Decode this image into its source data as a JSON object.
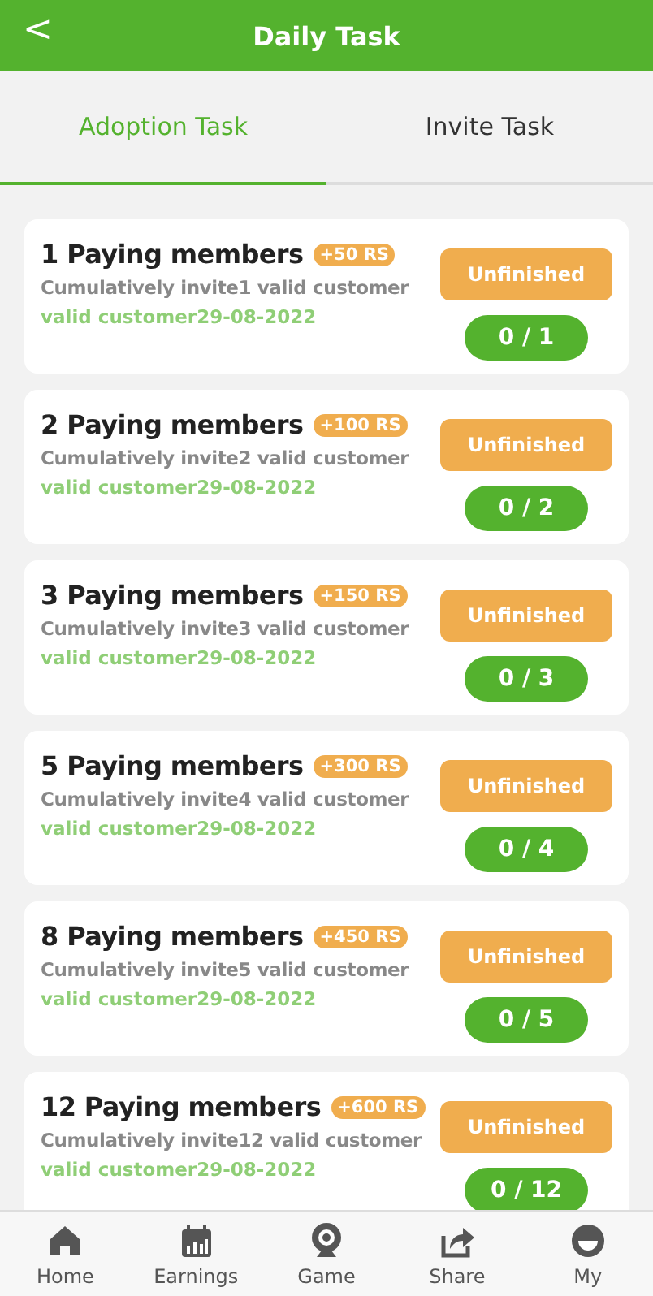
{
  "header": {
    "back": "<",
    "title": "Daily Task"
  },
  "tabs": [
    {
      "label": "Adoption Task",
      "selected": true
    },
    {
      "label": "Invite Task",
      "selected": false
    }
  ],
  "tasks": [
    {
      "title": "1 Paying members",
      "reward": "+50 RS",
      "description": "Cumulatively invite1 valid customer",
      "date": "valid customer29-08-2022",
      "status": "Unfinished",
      "progress": "0 / 1"
    },
    {
      "title": "2 Paying members",
      "reward": "+100 RS",
      "description": "Cumulatively invite2 valid customer",
      "date": "valid customer29-08-2022",
      "status": "Unfinished",
      "progress": "0 / 2"
    },
    {
      "title": "3 Paying members",
      "reward": "+150 RS",
      "description": "Cumulatively invite3 valid customer",
      "date": "valid customer29-08-2022",
      "status": "Unfinished",
      "progress": "0 / 3"
    },
    {
      "title": "5 Paying members",
      "reward": "+300 RS",
      "description": "Cumulatively invite4 valid customer",
      "date": "valid customer29-08-2022",
      "status": "Unfinished",
      "progress": "0 / 4"
    },
    {
      "title": "8 Paying members",
      "reward": "+450 RS",
      "description": "Cumulatively invite5 valid customer",
      "date": "valid customer29-08-2022",
      "status": "Unfinished",
      "progress": "0 / 5"
    },
    {
      "title": "12 Paying members",
      "reward": "+600 RS",
      "description": "Cumulatively invite12 valid customer",
      "date": "valid customer29-08-2022",
      "status": "Unfinished",
      "progress": "0 / 12"
    }
  ],
  "nav": [
    {
      "kind": "home",
      "label": "Home"
    },
    {
      "kind": "earnings",
      "label": "Earnings"
    },
    {
      "kind": "game",
      "label": "Game"
    },
    {
      "kind": "share",
      "label": "Share"
    },
    {
      "kind": "my",
      "label": "My"
    }
  ]
}
